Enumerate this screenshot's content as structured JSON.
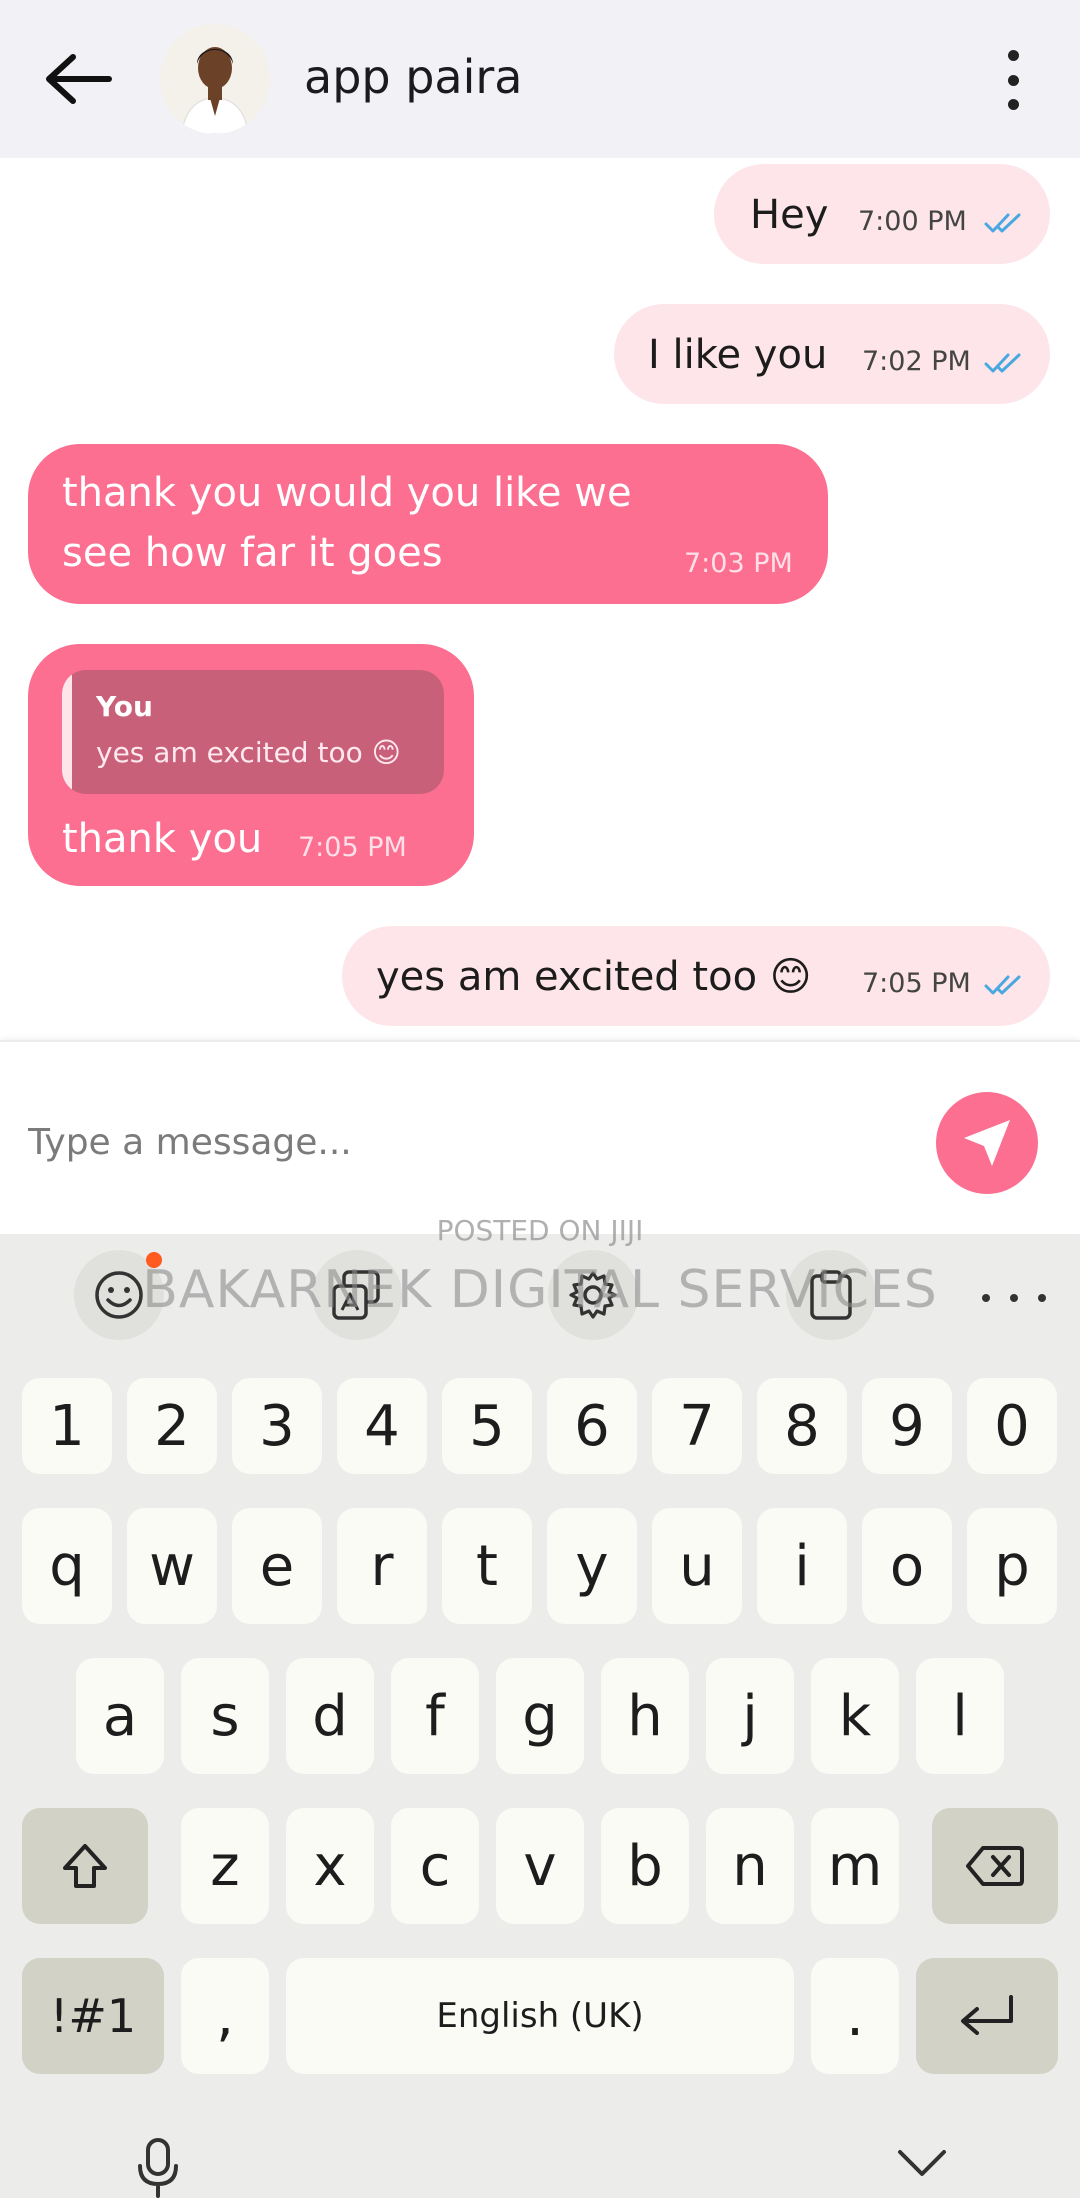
{
  "header": {
    "contact_name": "app paira"
  },
  "messages": [
    {
      "id": "m1",
      "direction": "outgoing",
      "text": "Hey",
      "time": "7:00 PM",
      "status": "read"
    },
    {
      "id": "m2",
      "direction": "outgoing",
      "text": "I like you",
      "time": "7:02 PM",
      "status": "read"
    },
    {
      "id": "m3",
      "direction": "incoming",
      "lines": [
        "thank you would you like we",
        "see how far it goes"
      ],
      "time": "7:03 PM"
    },
    {
      "id": "m4",
      "direction": "incoming",
      "quote": {
        "author": "You",
        "text": "yes am excited too 😊"
      },
      "text": "thank you",
      "time": "7:05 PM"
    },
    {
      "id": "m5",
      "direction": "outgoing",
      "text": "yes am excited too 😊",
      "time": "7:05 PM",
      "status": "read"
    }
  ],
  "composer": {
    "placeholder": "Type a message..."
  },
  "watermark": {
    "small": "POSTED ON JIJI",
    "big": "BAKARNEK DIGITAL SERVICES"
  },
  "keyboard": {
    "toolbar_icons": [
      "emoji-icon",
      "translate-icon",
      "settings-icon",
      "clipboard-icon",
      "more-icon"
    ],
    "rows": {
      "numbers": [
        "1",
        "2",
        "3",
        "4",
        "5",
        "6",
        "7",
        "8",
        "9",
        "0"
      ],
      "row1": [
        "q",
        "w",
        "e",
        "r",
        "t",
        "y",
        "u",
        "i",
        "o",
        "p"
      ],
      "row2": [
        "a",
        "s",
        "d",
        "f",
        "g",
        "h",
        "j",
        "k",
        "l"
      ],
      "row3": [
        "z",
        "x",
        "c",
        "v",
        "b",
        "n",
        "m"
      ]
    },
    "symbols_label": "!#1",
    "comma": ",",
    "space_label": "English (UK)",
    "period": "."
  },
  "colors": {
    "outgoing_bubble": "#fde5ea",
    "incoming_bubble": "#fc6f91",
    "quote_background": "#c96079",
    "accent": "#fc6f91",
    "read_ticks": "#4aa8e0",
    "header_background": "#f1f1f6",
    "keyboard_background": "#ececeb"
  }
}
